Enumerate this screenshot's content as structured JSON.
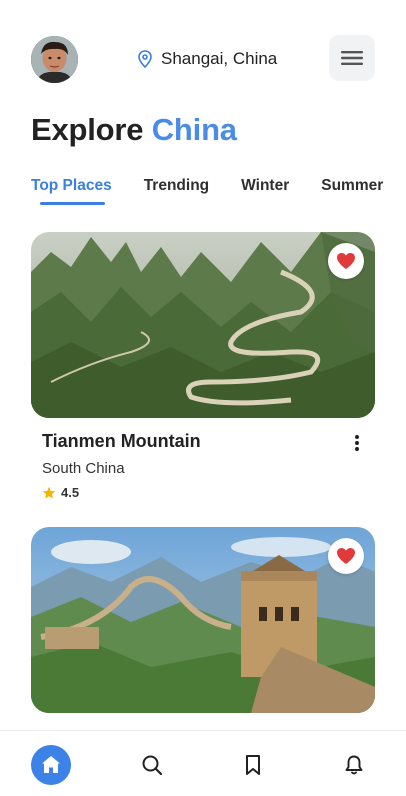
{
  "header": {
    "location": "Shangai, China",
    "avatar_alt": "profile avatar"
  },
  "title": {
    "prefix": "Explore ",
    "accent": "China"
  },
  "tabs": [
    {
      "label": "Top Places"
    },
    {
      "label": "Trending"
    },
    {
      "label": "Winter"
    },
    {
      "label": "Summer"
    }
  ],
  "cards": [
    {
      "name": "Tianmen Mountain",
      "region": "South China",
      "rating": "4.5",
      "favorite": true
    },
    {
      "favorite": true
    }
  ],
  "bottom_nav": [
    "home-icon",
    "search-icon",
    "bookmark-icon",
    "bell-icon"
  ],
  "colors": {
    "accent": "#4a8be8",
    "heart": "#e03b3b",
    "star": "#f5b400"
  }
}
